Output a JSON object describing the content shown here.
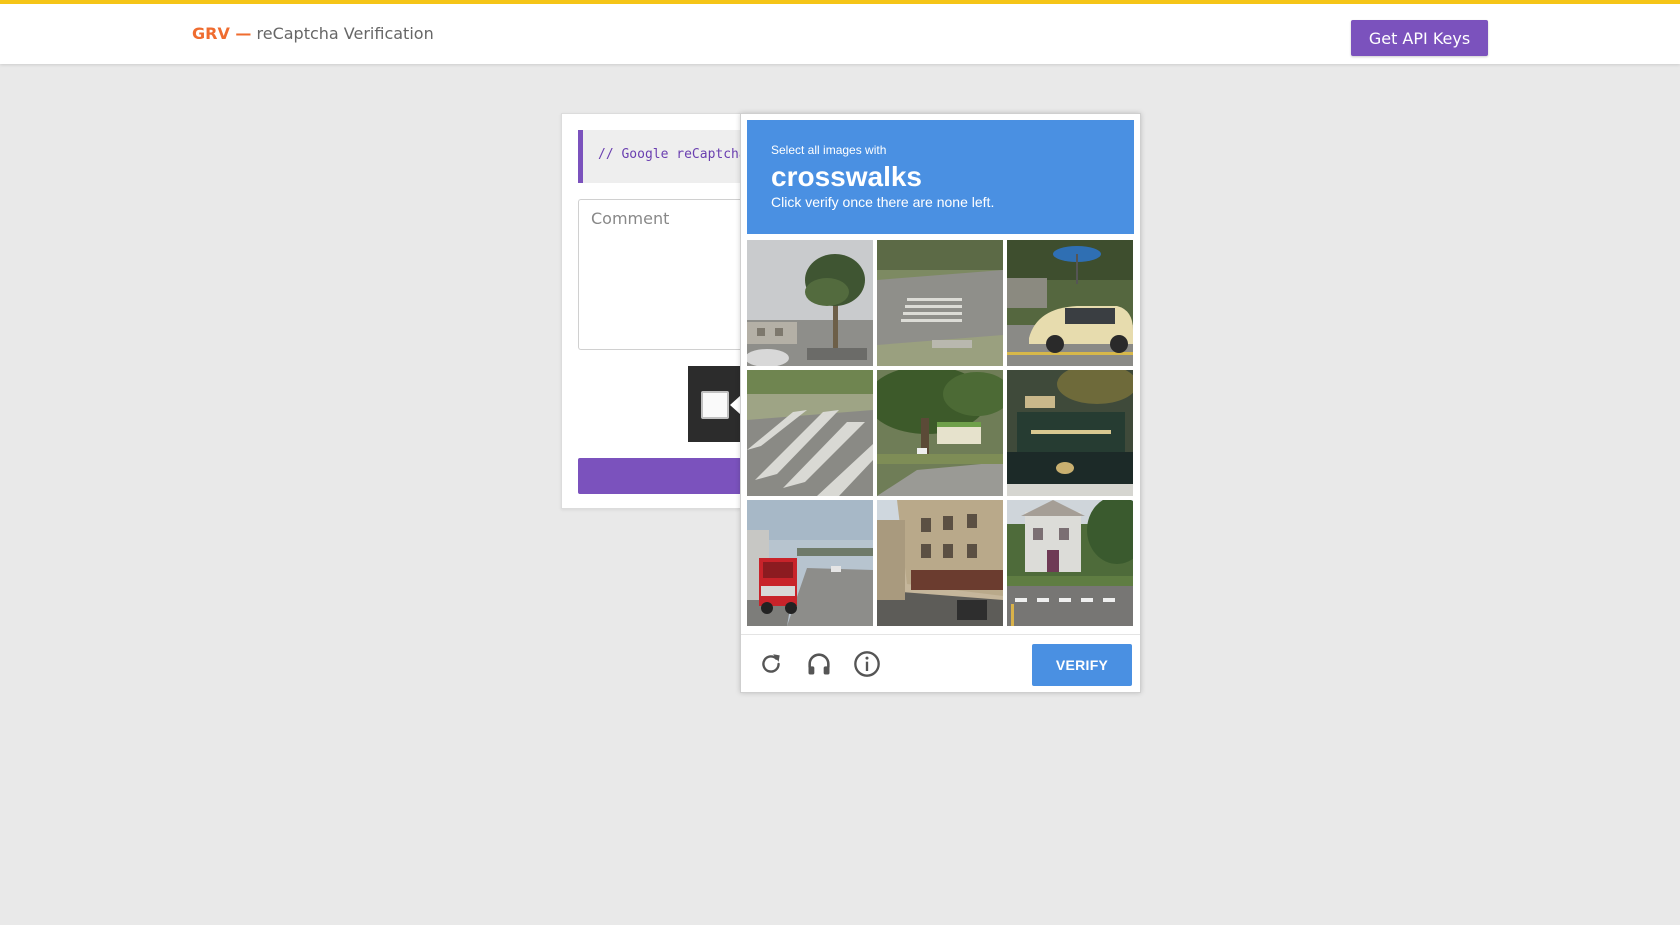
{
  "header": {
    "brand_short": "GRV —",
    "brand_title": "reCaptcha Verification",
    "api_button_label": "Get API Keys"
  },
  "form": {
    "code_comment": "// Google reCaptcha",
    "comment_placeholder": "Comment"
  },
  "challenge": {
    "instruction_top": "Select all images with",
    "target_object": "crosswalks",
    "instruction_bottom": "Click verify once there are none left.",
    "verify_label": "VERIFY",
    "footer_icons": [
      "reload-icon",
      "headphones-icon",
      "info-icon"
    ],
    "tiles": [
      {
        "id": 1,
        "scene": "palm tree"
      },
      {
        "id": 2,
        "scene": "crosswalk road"
      },
      {
        "id": 3,
        "scene": "taxi"
      },
      {
        "id": 4,
        "scene": "crosswalk road"
      },
      {
        "id": 5,
        "scene": "tree roadside"
      },
      {
        "id": 6,
        "scene": "storefront"
      },
      {
        "id": 7,
        "scene": "red truck highway"
      },
      {
        "id": 8,
        "scene": "street buildings"
      },
      {
        "id": 9,
        "scene": "house crosswalk"
      }
    ]
  },
  "colors": {
    "accent_purple": "#7b52bd",
    "brand_orange": "#ef6c2f",
    "top_border": "#f5c518",
    "captcha_blue": "#4a90e2"
  }
}
